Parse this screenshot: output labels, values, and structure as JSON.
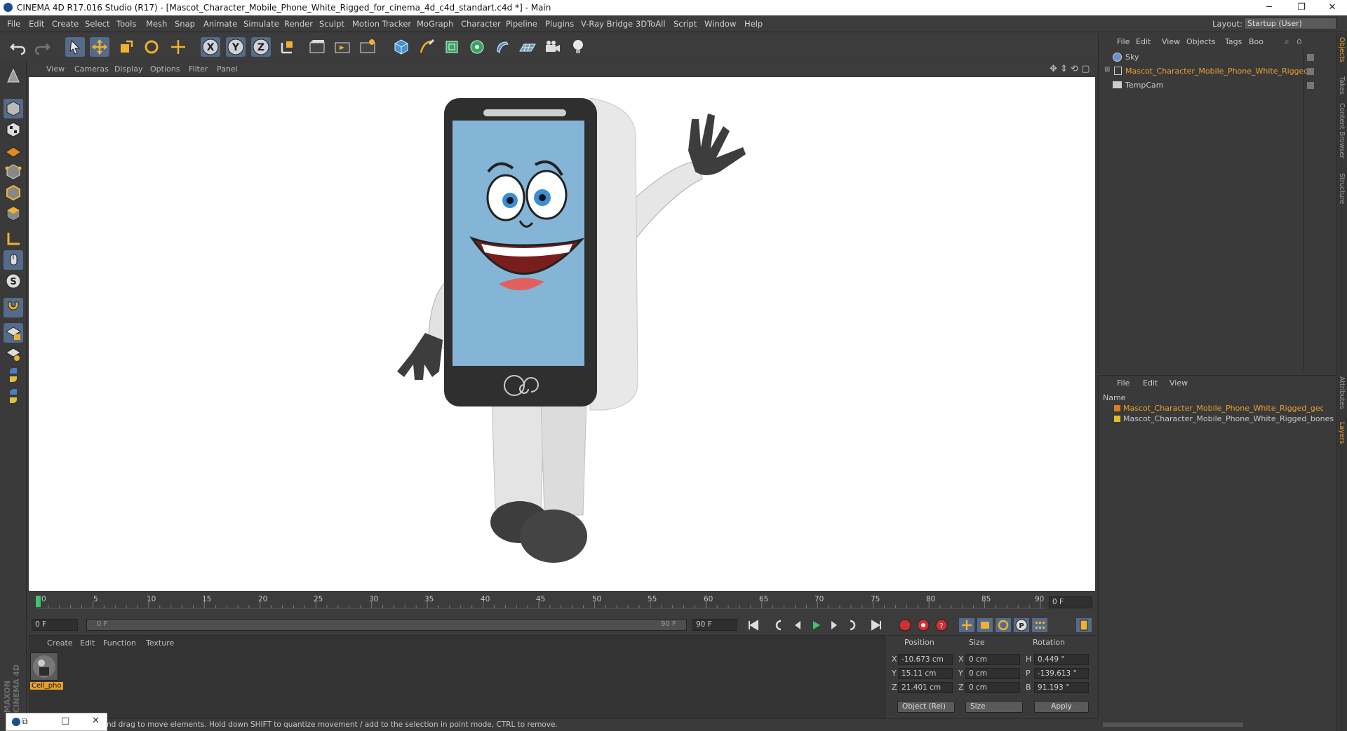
{
  "window": {
    "title": "CINEMA 4D R17.016 Studio (R17) - [Mascot_Character_Mobile_Phone_White_Rigged_for_cinema_4d_c4d_standart.c4d *] - Main",
    "minimize": "─",
    "maximize": "❐",
    "close": "✕"
  },
  "menu": [
    "File",
    "Edit",
    "Create",
    "Select",
    "Tools",
    "Mesh",
    "Snap",
    "Animate",
    "Simulate",
    "Render",
    "Sculpt",
    "Motion Tracker",
    "MoGraph",
    "Character",
    "Pipeline",
    "Plugins",
    "V-Ray Bridge",
    "3DToAll",
    "Script",
    "Window",
    "Help"
  ],
  "layout": {
    "label": "Layout:",
    "value": "Startup (User)"
  },
  "viewport_menu": [
    "View",
    "Cameras",
    "Display",
    "Options",
    "Filter",
    "Panel"
  ],
  "timeline": {
    "ticks": [
      "0",
      "5",
      "10",
      "15",
      "20",
      "25",
      "30",
      "35",
      "40",
      "45",
      "50",
      "55",
      "60",
      "65",
      "70",
      "75",
      "80",
      "85",
      "90"
    ],
    "current_frame": "0 F",
    "start_field": "0 F",
    "range_start": "0 F",
    "range_end": "90 F",
    "end_field": "90 F"
  },
  "material_menu": [
    "Create",
    "Edit",
    "Function",
    "Texture"
  ],
  "material": {
    "name": "Cell_pho"
  },
  "coords": {
    "headers": {
      "position": "Position",
      "size": "Size",
      "rotation": "Rotation"
    },
    "rows": [
      {
        "axis": "X",
        "pos": "-10.673 cm",
        "size_axis": "X",
        "size": "0 cm",
        "rot_axis": "H",
        "rot": "0.449 °"
      },
      {
        "axis": "Y",
        "pos": "15.11 cm",
        "size_axis": "Y",
        "size": "0 cm",
        "rot_axis": "P",
        "rot": "-139.613 °"
      },
      {
        "axis": "Z",
        "pos": "21.401 cm",
        "size_axis": "Z",
        "size": "0 cm",
        "rot_axis": "B",
        "rot": "91.193 °"
      }
    ],
    "mode": "Object (Rel)",
    "size_mode": "Size",
    "apply": "Apply"
  },
  "status": "nd drag to move elements. Hold down SHIFT to quantize movement / add to the selection in point mode, CTRL to remove.",
  "object_menu": [
    "File",
    "Edit",
    "View",
    "Objects",
    "Tags",
    "Boo"
  ],
  "objects": [
    {
      "name": "Sky",
      "color": "#c8c8c8"
    },
    {
      "name": "Mascot_Character_Mobile_Phone_White_Rigged",
      "color": "#e8a030"
    },
    {
      "name": "TempCam",
      "color": "#c8c8c8"
    }
  ],
  "layer_menu": [
    "File",
    "Edit",
    "View"
  ],
  "layer_header": "Name",
  "layers": [
    {
      "name": "Mascot_Character_Mobile_Phone_White_Rigged_geometry",
      "swatch": "#e07a20",
      "color": "#e8a030"
    },
    {
      "name": "Mascot_Character_Mobile_Phone_White_Rigged_bones",
      "swatch": "#e0c020",
      "color": "#c8c8c8"
    }
  ],
  "side_tabs": [
    "Objects",
    "Takes",
    "Content Browser",
    "Structure",
    "Attributes",
    "Layers"
  ],
  "brand": "MAXON CINEMA 4D",
  "accent": "#e8a030"
}
